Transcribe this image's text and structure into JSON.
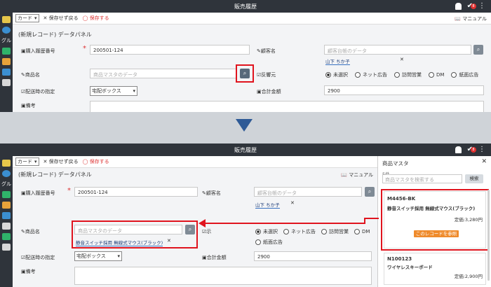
{
  "app_title": "販売履歴",
  "badge_count": "8",
  "nav_label": "グル",
  "toolbar": {
    "card_select": "カード",
    "cancel_label": "保存せず戻る",
    "save_label": "保存する",
    "manual_label": "マニュアル"
  },
  "heading": "(新規レコード) データパネル",
  "fields": {
    "purchase_no_label": "購入履歴番号",
    "purchase_no_value": "200501-124",
    "customer_label": "顧客名",
    "customer_placeholder": "顧客台帳のデータ",
    "customer_tag": "山下 ちか子",
    "product_label": "商品名",
    "product_placeholder": "商品マスタのデータ",
    "product_tag": "静音スイッチ採用 無線式マウス(ブラック)",
    "source_label": "反響元",
    "source_label_partial": "示",
    "source_options": [
      "未選択",
      "ネット広告",
      "訪問営業",
      "DM",
      "紙面広告"
    ],
    "source_options_bottom": [
      "未選択",
      "ネット広告",
      "訪問営業",
      "DM"
    ],
    "delivery_label": "配送時の指定",
    "delivery_value": "宅配ボックス",
    "total_label": "合計金額",
    "total_value": "2900",
    "notes_label": "備考"
  },
  "drawer": {
    "title": "商品マスタ",
    "count": "5件",
    "search_placeholder": "商品マスタを検索する",
    "search_button": "検索",
    "ref_button": "このレコードを参照",
    "items": [
      {
        "code": "M4456-BK",
        "name": "静音スイッチ採用 無線式マウス(ブラック)",
        "price": "定価:3,280円"
      },
      {
        "code": "N100123",
        "name": "ワイヤレスキーボード",
        "price": "定価:2,900円"
      }
    ]
  },
  "icons": {
    "search": "search-icon",
    "close": "close-icon",
    "bell": "bell-icon",
    "check": "check-icon",
    "more": "more-icon"
  },
  "colors": {
    "highlight": "#e0141e",
    "accent_orange": "#ef8b2c",
    "arrow": "#2e5a96",
    "titlebar": "#2f343b"
  }
}
